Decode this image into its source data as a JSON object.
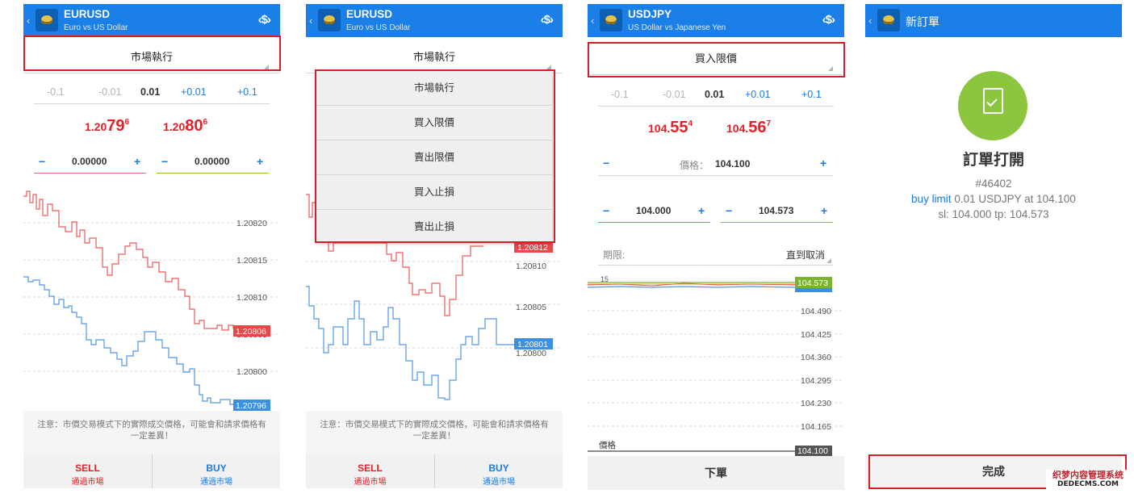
{
  "panel1": {
    "header": {
      "symbol": "EURUSD",
      "description": "Euro vs US Dollar"
    },
    "order_type": "市場執行",
    "volume": {
      "steps": [
        "-0.1",
        "-0.01",
        "+0.01",
        "+0.1"
      ],
      "current": "0.01"
    },
    "bid": {
      "small": "1.20",
      "big": "79",
      "sup": "6"
    },
    "ask": {
      "small": "1.20",
      "big": "80",
      "sup": "6"
    },
    "stop_loss": "0.00000",
    "take_profit": "0.00000",
    "chart_axis": [
      "1.20820",
      "1.20815",
      "1.20810",
      "1.20805",
      "1.20800"
    ],
    "ask_badge": "1.20806",
    "bid_badge": "1.20796",
    "note": "注意：市價交易模式下的實際成交價格，可能會和請求價格有一定差異！",
    "sell": {
      "label": "SELL",
      "sub": "通過市場"
    },
    "buy": {
      "label": "BUY",
      "sub": "通過市場"
    }
  },
  "panel2": {
    "header": {
      "symbol": "EURUSD",
      "description": "Euro vs US Dollar"
    },
    "order_type": "市場執行",
    "menu": [
      "市場執行",
      "買入限價",
      "賣出限價",
      "買入止損",
      "賣出止損"
    ],
    "chart_axis": [
      "1.20810",
      "1.20805",
      "1.20800"
    ],
    "ask_badge": "1.20812",
    "bid_badge": "1.20801",
    "note": "注意：市價交易模式下的實際成交價格，可能會和請求價格有一定差異！",
    "sell": {
      "label": "SELL",
      "sub": "通過市場"
    },
    "buy": {
      "label": "BUY",
      "sub": "通過市場"
    }
  },
  "panel3": {
    "header": {
      "symbol": "USDJPY",
      "description": "US Dollar vs Japanese Yen"
    },
    "order_type": "買入限價",
    "volume": {
      "steps": [
        "-0.1",
        "-0.01",
        "+0.01",
        "+0.1"
      ],
      "current": "0.01"
    },
    "bid": {
      "small": "104.",
      "big": "55",
      "sup": "4"
    },
    "ask": {
      "small": "104.",
      "big": "56",
      "sup": "7"
    },
    "price_label": "價格：",
    "price_value": "104.100",
    "stop_loss": "104.000",
    "take_profit": "104.573",
    "expiry_label": "期限:",
    "expiry_value": "直到取消",
    "tp_badge": "104.573",
    "chart_axis": [
      "104.490",
      "104.425",
      "104.360",
      "104.295",
      "104.230",
      "104.165"
    ],
    "price_line_label": "價格",
    "price_badge": "104.100",
    "submit": "下單"
  },
  "panel4": {
    "header_title": "新訂單",
    "status_title": "訂單打開",
    "ticket": "#46402",
    "order_kind": "buy limit",
    "order_detail": "0.01 USDJPY at 104.100",
    "sltp": "sl: 104.000 tp: 104.573",
    "done": "完成"
  },
  "watermark": {
    "line1": "织梦内容管理系统",
    "line2": "DEDECMS.COM"
  },
  "colors": {
    "header_blue": "#1a80e8",
    "sell_red": "#e0222a",
    "buy_blue": "#1a7be0",
    "tp_green": "#8ac53c",
    "highlight_red": "#d0202a",
    "success_green": "#8cc63f"
  }
}
